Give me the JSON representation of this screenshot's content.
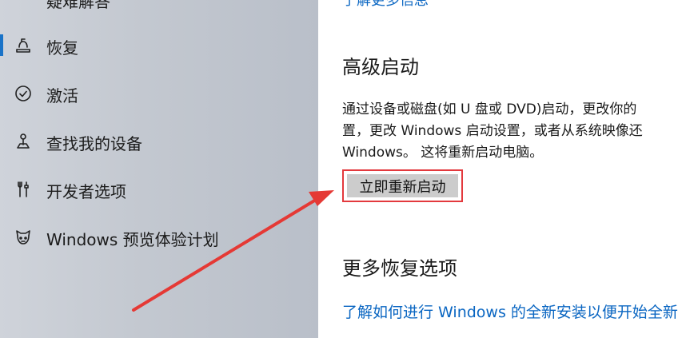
{
  "sidebar": {
    "partial_item": "疑难解答",
    "items": [
      {
        "label": "恢复",
        "icon": "recovery-icon",
        "active": true
      },
      {
        "label": "激活",
        "icon": "activation-check-icon"
      },
      {
        "label": "查找我的设备",
        "icon": "find-my-device-icon"
      },
      {
        "label": "开发者选项",
        "icon": "developer-options-icon"
      },
      {
        "label": "Windows 预览体验计划",
        "icon": "insider-program-icon"
      }
    ],
    "accent_color": "#1a73c8"
  },
  "main": {
    "top_link": "了解更多信息",
    "advanced_startup": {
      "title": "高级启动",
      "description_lines": [
        "通过设备或磁盘(如 U 盘或 DVD)启动，更改你的",
        "置，更改 Windows 启动设置，或者从系统映像还",
        "Windows。  这将重新启动电脑。"
      ],
      "restart_button": "立即重新启动"
    },
    "more_recovery": {
      "title": "更多恢复选项",
      "link": "了解如何进行 Windows 的全新安装以便开始全新"
    },
    "link_color": "#0a66c2"
  },
  "annotation": {
    "arrow_color": "#e53935",
    "highlight_color": "#e3393d"
  }
}
